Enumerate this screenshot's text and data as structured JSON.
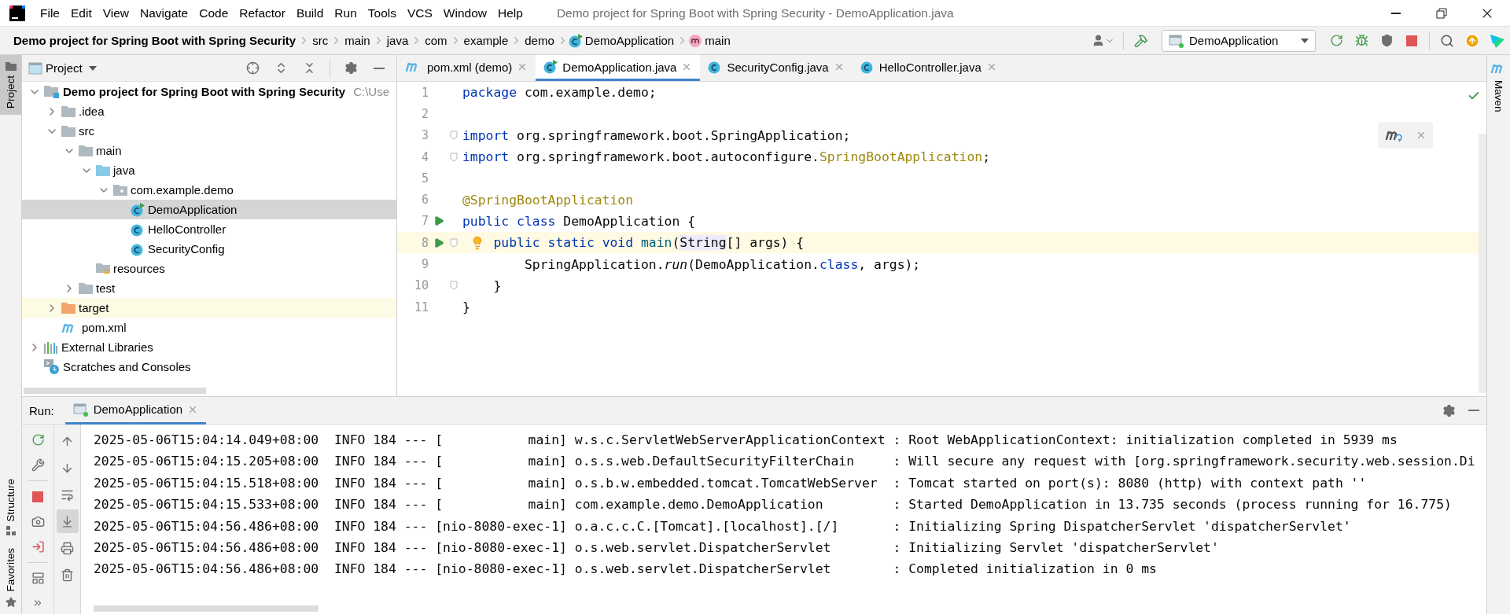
{
  "window": {
    "title": "Demo project for Spring Boot with Spring Security - DemoApplication.java"
  },
  "menu": [
    "File",
    "Edit",
    "View",
    "Navigate",
    "Code",
    "Refactor",
    "Build",
    "Run",
    "Tools",
    "VCS",
    "Window",
    "Help"
  ],
  "breadcrumb": [
    {
      "label": "Demo project for Spring Boot with Spring Security",
      "kind": "project"
    },
    {
      "label": "src",
      "kind": "folder"
    },
    {
      "label": "main",
      "kind": "folder"
    },
    {
      "label": "java",
      "kind": "folder"
    },
    {
      "label": "com",
      "kind": "folder"
    },
    {
      "label": "example",
      "kind": "folder"
    },
    {
      "label": "demo",
      "kind": "folder"
    },
    {
      "label": "DemoApplication",
      "kind": "main-class"
    },
    {
      "label": "main",
      "kind": "method"
    }
  ],
  "toolbar": {
    "run_config": "DemoApplication"
  },
  "left_tool_tabs": [
    {
      "label": "Project",
      "kind": "project",
      "selected": true
    },
    {
      "label": "Structure",
      "kind": "structure",
      "selected": false
    },
    {
      "label": "Favorites",
      "kind": "favorites",
      "selected": false
    }
  ],
  "right_tool_tabs": [
    {
      "label": "Maven",
      "selected": false
    }
  ],
  "project_panel": {
    "title": "Project",
    "tree": [
      {
        "label": "Demo project for Spring Boot with Spring Security",
        "hint": "C:\\Use",
        "kind": "project",
        "expanded": true,
        "selected": false,
        "children": [
          {
            "label": ".idea",
            "kind": "folder",
            "expanded": false,
            "selected": false
          },
          {
            "label": "src",
            "kind": "folder",
            "expanded": true,
            "selected": false,
            "children": [
              {
                "label": "main",
                "kind": "folder",
                "expanded": true,
                "selected": false,
                "children": [
                  {
                    "label": "java",
                    "kind": "source-folder",
                    "expanded": true,
                    "selected": false,
                    "children": [
                      {
                        "label": "com.example.demo",
                        "kind": "package",
                        "expanded": true,
                        "selected": false,
                        "children": [
                          {
                            "label": "DemoApplication",
                            "kind": "main-class",
                            "selected": true
                          },
                          {
                            "label": "HelloController",
                            "kind": "class",
                            "selected": false
                          },
                          {
                            "label": "SecurityConfig",
                            "kind": "class",
                            "selected": false
                          }
                        ]
                      }
                    ]
                  },
                  {
                    "label": "resources",
                    "kind": "resources-folder",
                    "selected": false
                  }
                ]
              },
              {
                "label": "test",
                "kind": "folder",
                "expanded": false,
                "selected": false
              }
            ]
          },
          {
            "label": "target",
            "kind": "excluded-folder",
            "expanded": false,
            "selected": false
          },
          {
            "label": "pom.xml",
            "kind": "maven",
            "selected": false
          }
        ]
      },
      {
        "label": "External Libraries",
        "kind": "libraries",
        "expanded": false,
        "selected": false
      },
      {
        "label": "Scratches and Consoles",
        "kind": "scratches",
        "selected": false
      }
    ]
  },
  "editor": {
    "tabs": [
      {
        "label": "pom.xml (demo)",
        "kind": "maven",
        "selected": false
      },
      {
        "label": "DemoApplication.java",
        "kind": "main-class",
        "selected": true
      },
      {
        "label": "SecurityConfig.java",
        "kind": "class",
        "selected": false
      },
      {
        "label": "HelloController.java",
        "kind": "class",
        "selected": false
      }
    ],
    "lines": [
      {
        "number": "1",
        "current": false,
        "run": false,
        "fold": false,
        "bulb": false,
        "tokens": [
          {
            "kind": "keyword",
            "text": "package"
          },
          {
            "kind": "plain",
            "text": " com.example.demo;"
          }
        ]
      },
      {
        "number": "2",
        "current": false,
        "run": false,
        "fold": false,
        "bulb": false
      },
      {
        "number": "3",
        "current": false,
        "run": false,
        "fold": true,
        "bulb": false,
        "tokens": [
          {
            "kind": "keyword",
            "text": "import"
          },
          {
            "kind": "plain",
            "text": " org.springframework.boot.SpringApplication;"
          }
        ]
      },
      {
        "number": "4",
        "current": false,
        "run": false,
        "fold": true,
        "bulb": false,
        "tokens": [
          {
            "kind": "keyword",
            "text": "import"
          },
          {
            "kind": "plain",
            "text": " org.springframework.boot.autoconfigure."
          },
          {
            "kind": "annotation",
            "text": "SpringBootApplication"
          },
          {
            "kind": "plain",
            "text": ";"
          }
        ]
      },
      {
        "number": "5",
        "current": false,
        "run": false,
        "fold": false,
        "bulb": false
      },
      {
        "number": "6",
        "current": false,
        "run": false,
        "fold": false,
        "bulb": false,
        "tokens": [
          {
            "kind": "annotation",
            "text": "@SpringBootApplication"
          }
        ]
      },
      {
        "number": "7",
        "current": false,
        "run": true,
        "fold": false,
        "bulb": false,
        "tokens": [
          {
            "kind": "keyword",
            "text": "public"
          },
          {
            "kind": "keyword",
            "text": " class"
          },
          {
            "kind": "plain",
            "text": " DemoApplication {"
          }
        ]
      },
      {
        "number": "8",
        "current": true,
        "run": true,
        "fold": true,
        "bulb": true,
        "tokens": [
          {
            "kind": "keyword",
            "text": "    public"
          },
          {
            "kind": "keyword",
            "text": " static"
          },
          {
            "kind": "keyword",
            "text": " void"
          },
          {
            "kind": "method",
            "text": " main"
          },
          {
            "kind": "plain",
            "text": "("
          },
          {
            "kind": "highlight",
            "text": "String"
          },
          {
            "kind": "plain",
            "text": "[] args) {"
          }
        ]
      },
      {
        "number": "9",
        "current": false,
        "run": false,
        "fold": false,
        "bulb": false,
        "tokens": [
          {
            "kind": "plain",
            "text": "        SpringApplication."
          },
          {
            "kind": "italic",
            "text": "run"
          },
          {
            "kind": "plain",
            "text": "(DemoApplication."
          },
          {
            "kind": "keyword",
            "text": "class"
          },
          {
            "kind": "plain",
            "text": ", args);"
          }
        ]
      },
      {
        "number": "10",
        "current": false,
        "run": false,
        "fold": true,
        "bulb": false,
        "tokens": [
          {
            "kind": "plain",
            "text": "    }"
          }
        ]
      },
      {
        "number": "11",
        "current": false,
        "run": false,
        "fold": false,
        "bulb": false,
        "tokens": [
          {
            "kind": "plain",
            "text": "}"
          }
        ]
      }
    ]
  },
  "run_panel": {
    "label": "Run:",
    "scroll_to_end_on": true,
    "tabs": [
      {
        "label": "DemoApplication",
        "selected": true
      }
    ],
    "console": [
      "2025-05-06T15:04:14.049+08:00  INFO 184 --- [           main] w.s.c.ServletWebServerApplicationContext : Root WebApplicationContext: initialization completed in 5939 ms",
      "2025-05-06T15:04:15.205+08:00  INFO 184 --- [           main] o.s.s.web.DefaultSecurityFilterChain     : Will secure any request with [org.springframework.security.web.session.Di",
      "2025-05-06T15:04:15.518+08:00  INFO 184 --- [           main] o.s.b.w.embedded.tomcat.TomcatWebServer  : Tomcat started on port(s): 8080 (http) with context path ''",
      "2025-05-06T15:04:15.533+08:00  INFO 184 --- [           main] com.example.demo.DemoApplication         : Started DemoApplication in 13.735 seconds (process running for 16.775)",
      "2025-05-06T15:04:56.486+08:00  INFO 184 --- [nio-8080-exec-1] o.a.c.c.C.[Tomcat].[localhost].[/]       : Initializing Spring DispatcherServlet 'dispatcherServlet'",
      "2025-05-06T15:04:56.486+08:00  INFO 184 --- [nio-8080-exec-1] o.s.web.servlet.DispatcherServlet        : Initializing Servlet 'dispatcherServlet'",
      "2025-05-06T15:04:56.486+08:00  INFO 184 --- [nio-8080-exec-1] o.s.web.servlet.DispatcherServlet        : Completed initialization in 0 ms"
    ]
  }
}
